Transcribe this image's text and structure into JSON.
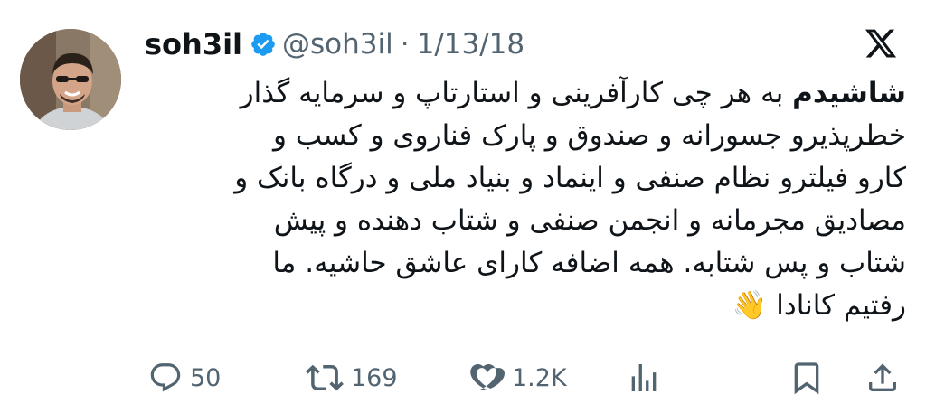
{
  "tweet": {
    "display_name": "soh3il",
    "handle": "@soh3il",
    "separator": "·",
    "date": "1/13/18",
    "text_bold": "شاشیدم",
    "text_rest": " به هر چی کارآفرینی و استارتاپ و سرمایه گذار\nخطرپذیرو جسورانه و صندوق و پارک فناروی و کسب و\nکارو فیلترو نظام صنفی و اینماد و بنیاد ملی و درگاه بانک و\nمصادیق مجرمانه و انجمن صنفی و شتاب دهنده و پیش\nشتاب و پس شتابه. همه اضافه کارای عاشق حاشیه. ما\nرفتیم کانادا 👋"
  },
  "actions": {
    "replies": "50",
    "retweets": "169",
    "likes": "1.2K"
  },
  "colors": {
    "text": "#0f1419",
    "secondary": "#536471",
    "verified": "#1d9bf0"
  },
  "icons": {
    "verified": "verified-badge-icon",
    "logo": "x-logo-icon",
    "reply": "reply-icon",
    "retweet": "retweet-icon",
    "like": "heart-icon",
    "views": "views-icon",
    "bookmark": "bookmark-icon",
    "share": "share-icon"
  }
}
